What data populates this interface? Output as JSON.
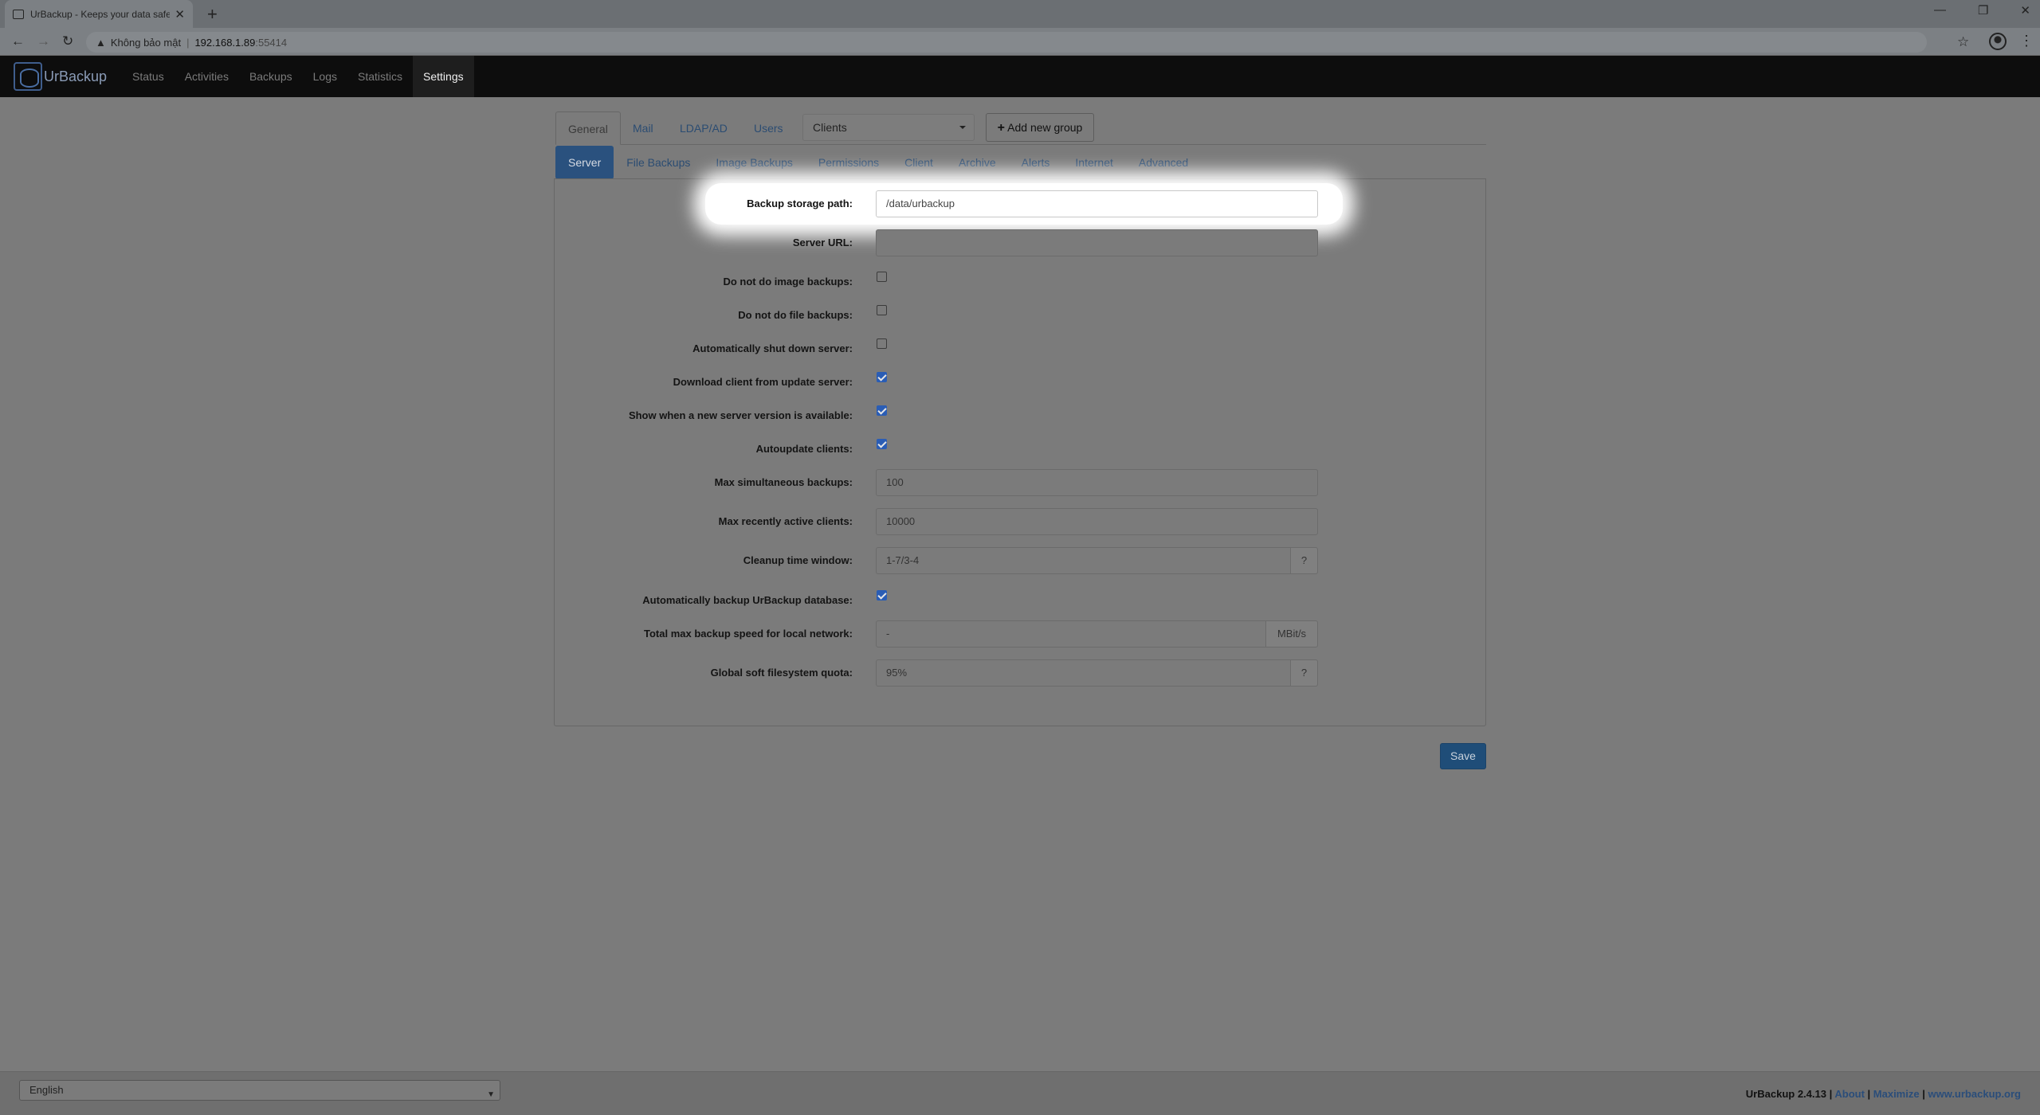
{
  "browser": {
    "tab_title": "UrBackup - Keeps your data safe",
    "tab_close": "✕",
    "new_tab": "+",
    "window_controls": {
      "minimize": "—",
      "restore": "❐",
      "close": "✕"
    },
    "nav": {
      "back": "←",
      "forward": "→",
      "reload": "↻"
    },
    "security_icon": "▲",
    "security_text": "Không bảo mật",
    "url_host": "192.168.1.89",
    "url_port": ":55414",
    "bookmark_icon": "☆",
    "menu_icon": "⋮"
  },
  "navbar": {
    "brand": "UrBackup",
    "items": [
      {
        "label": "Status"
      },
      {
        "label": "Activities"
      },
      {
        "label": "Backups"
      },
      {
        "label": "Logs"
      },
      {
        "label": "Statistics"
      },
      {
        "label": "Settings",
        "active": true
      }
    ]
  },
  "settings": {
    "top_tabs": [
      {
        "label": "General",
        "active": true
      },
      {
        "label": "Mail"
      },
      {
        "label": "LDAP/AD"
      },
      {
        "label": "Users"
      }
    ],
    "group_select": "Clients",
    "add_group": {
      "icon": "+",
      "label": "Add new group"
    },
    "sub_tabs": [
      {
        "label": "Server",
        "active": true
      },
      {
        "label": "File Backups"
      },
      {
        "label": "Image Backups"
      },
      {
        "label": "Permissions"
      },
      {
        "label": "Client"
      },
      {
        "label": "Archive"
      },
      {
        "label": "Alerts"
      },
      {
        "label": "Internet"
      },
      {
        "label": "Advanced"
      }
    ],
    "rows": {
      "backup_storage_path": {
        "label": "Backup storage path:",
        "value": "/data/urbackup"
      },
      "server_url": {
        "label": "Server URL:",
        "value": ""
      },
      "no_image_backups": {
        "label": "Do not do image backups:",
        "checked": false
      },
      "no_file_backups": {
        "label": "Do not do file backups:",
        "checked": false
      },
      "auto_shutdown": {
        "label": "Automatically shut down server:",
        "checked": false
      },
      "download_client": {
        "label": "Download client from update server:",
        "checked": true
      },
      "show_new_version": {
        "label": "Show when a new server version is available:",
        "checked": true
      },
      "autoupdate_clients": {
        "label": "Autoupdate clients:",
        "checked": true
      },
      "max_simultaneous": {
        "label": "Max simultaneous backups:",
        "value": "100"
      },
      "max_recent_clients": {
        "label": "Max recently active clients:",
        "value": "10000"
      },
      "cleanup_window": {
        "label": "Cleanup time window:",
        "value": "1-7/3-4",
        "addon": "?"
      },
      "auto_backup_db": {
        "label": "Automatically backup UrBackup database:",
        "checked": true
      },
      "total_max_speed": {
        "label": "Total max backup speed for local network:",
        "value": "-",
        "addon": "MBit/s"
      },
      "soft_quota": {
        "label": "Global soft filesystem quota:",
        "value": "95%",
        "addon": "?"
      }
    },
    "save": "Save"
  },
  "footer": {
    "language": "English",
    "version": "UrBackup 2.4.13",
    "sep": " | ",
    "about": "About",
    "maximize": "Maximize",
    "site": "www.urbackup.org"
  }
}
